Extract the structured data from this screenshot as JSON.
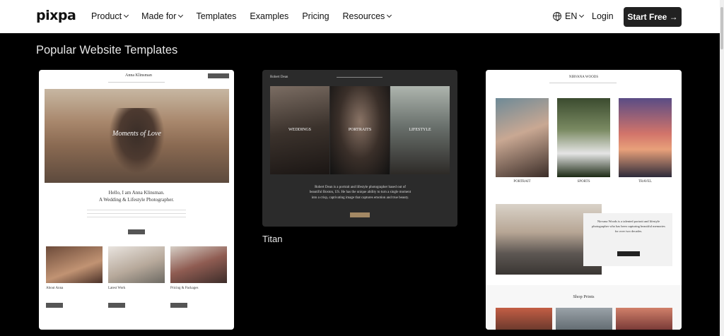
{
  "header": {
    "logo": "pixpa",
    "menu": [
      {
        "label": "Product",
        "dropdown": true
      },
      {
        "label": "Made for",
        "dropdown": true
      },
      {
        "label": "Templates",
        "dropdown": false
      },
      {
        "label": "Examples",
        "dropdown": false
      },
      {
        "label": "Pricing",
        "dropdown": false
      },
      {
        "label": "Resources",
        "dropdown": true
      }
    ],
    "language": "EN",
    "login": "Login",
    "cta": "Start Free →"
  },
  "section_title": "Popular Website Templates",
  "templates": {
    "first": {
      "site_name": "Anna Klinsman",
      "hero_text": "Moments of Love",
      "heading_line1": "Hello, I am Anna Klinsman.",
      "heading_line2": "A Wedding & Lifestyle Photographer.",
      "columns": [
        "About Anna",
        "Latest Work",
        "Pricing & Packages"
      ]
    },
    "titan": {
      "label": "Titan",
      "site_name": "Robert Dean",
      "panels": [
        "WEDDINGS",
        "PORTRAITS",
        "LIFESTYLE"
      ],
      "bio": "Robert Dean is a portrait and lifestyle photographer based out of beautiful Boston, US. He has the unique ability to turn a single moment into a crisp, captivating image that captures emotion and true beauty."
    },
    "third": {
      "site_name": "NIRVANA WOODS",
      "categories": [
        "PORTRAIT",
        "SPORTS",
        "TRAVEL"
      ],
      "bio": "Nirvana Woods is a talented portrait and lifestyle photographer who has been capturing beautiful memories for over two decades.",
      "shop_title": "Shop Prints"
    }
  }
}
